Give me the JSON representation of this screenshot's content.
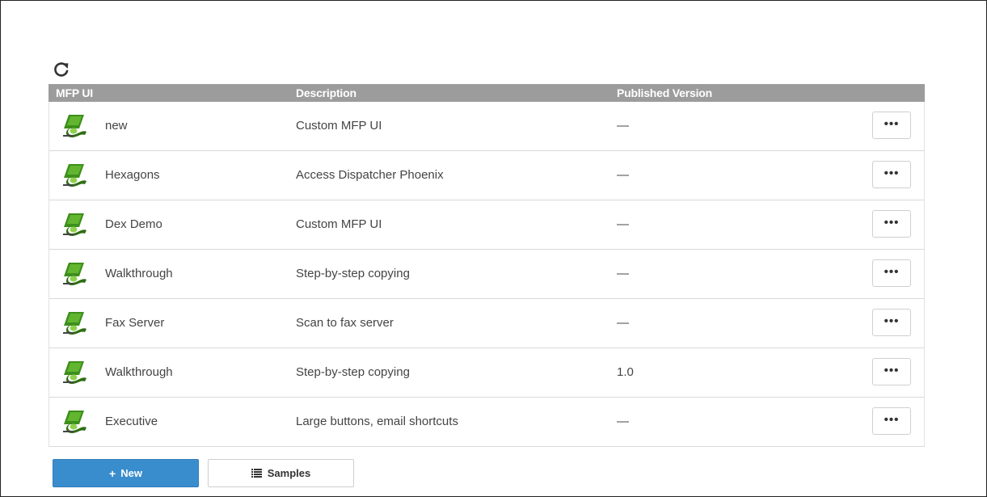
{
  "toolbar": {
    "refresh_icon": "refresh-icon"
  },
  "table": {
    "columns": [
      "MFP UI",
      "Description",
      "Published Version"
    ],
    "rows": [
      {
        "name": "new",
        "description": "Custom MFP UI",
        "version": "—",
        "more": "•••"
      },
      {
        "name": "Hexagons",
        "description": "Access Dispatcher Phoenix",
        "version": "—",
        "more": "•••"
      },
      {
        "name": "Dex Demo",
        "description": "Custom MFP UI",
        "version": "—",
        "more": "•••"
      },
      {
        "name": "Walkthrough",
        "description": "Step-by-step copying",
        "version": "—",
        "more": "•••"
      },
      {
        "name": "Fax Server",
        "description": "Scan to fax server",
        "version": "—",
        "more": "•••"
      },
      {
        "name": "Walkthrough",
        "description": "Step-by-step copying",
        "version": "1.0",
        "more": "•••"
      },
      {
        "name": "Executive",
        "description": "Large buttons, email shortcuts",
        "version": "—",
        "more": "•••"
      }
    ]
  },
  "actions": {
    "new_label": "New",
    "new_icon": "plus",
    "samples_label": "Samples",
    "samples_icon": "list-icon"
  },
  "colors": {
    "header_bg": "#9c9c9c",
    "primary": "#3a8dcd",
    "icon_green": "#3d8f1c"
  }
}
